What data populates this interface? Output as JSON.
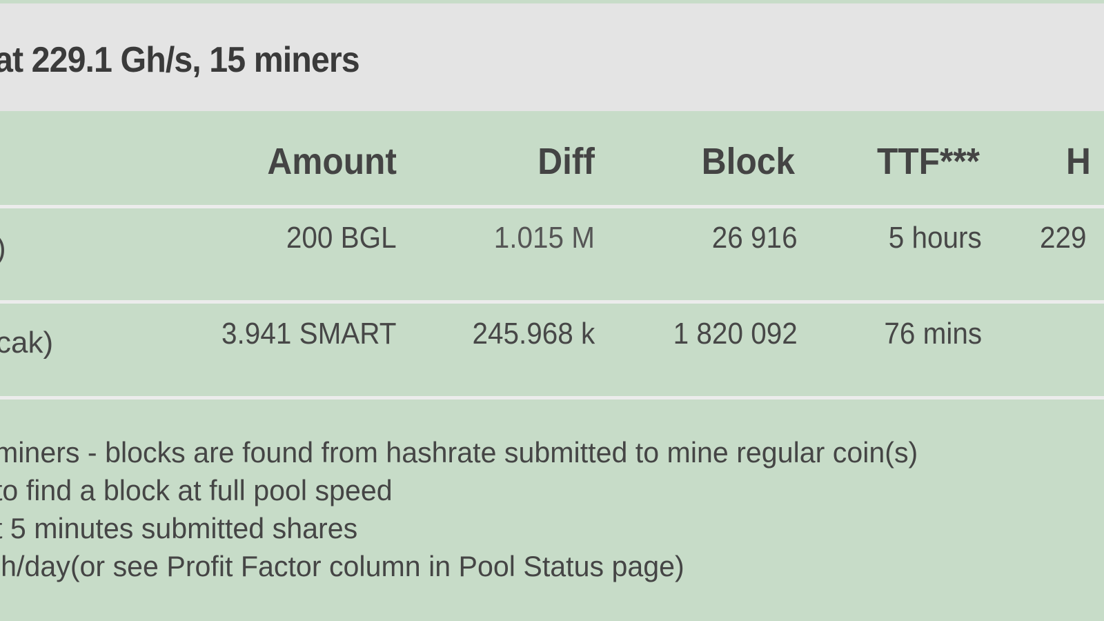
{
  "header": {
    "title": "at 229.1 Gh/s, 15 miners"
  },
  "table": {
    "columns": [
      "Amount",
      "Diff",
      "Block",
      "TTF***",
      "H"
    ],
    "rows": [
      {
        "name_fragment": ")",
        "amount": "200 BGL",
        "diff": "1.015 M",
        "block": "26 916",
        "ttf": "5 hours",
        "hashrate_fragment": "229"
      },
      {
        "name_fragment": "cak)",
        "amount": "3.941 SMART",
        "diff": "245.968 k",
        "block": "1 820 092",
        "ttf": "76 mins",
        "hashrate_fragment": ""
      }
    ]
  },
  "footnotes": [
    "miners - blocks are found from hashrate submitted to mine regular coin(s)",
    "to find a block at full pool speed",
    "t 5 minutes submitted shares",
    "lh/day(or see Profit Factor column in Pool Status page)"
  ]
}
